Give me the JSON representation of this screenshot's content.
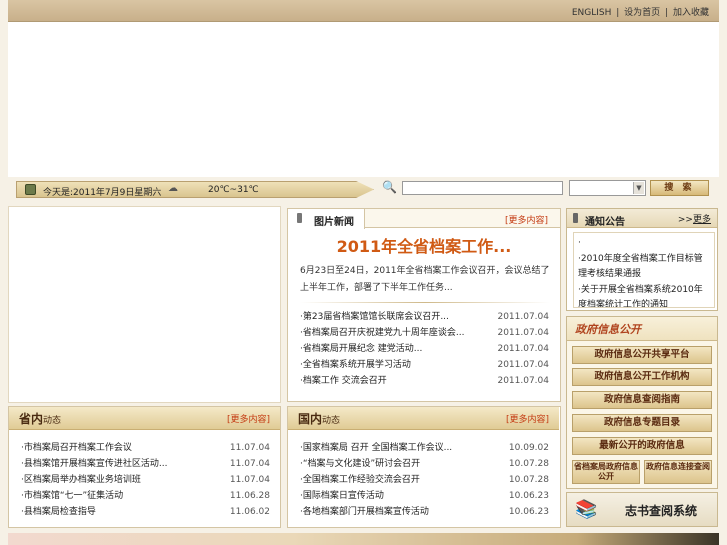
{
  "top_links": {
    "english": "ENGLISH",
    "sep": "|",
    "link2": "设为首页",
    "link3": "加入收藏"
  },
  "status": {
    "date": "今天是:2011年7月9日星期六",
    "temp": "20℃~31℃"
  },
  "search": {
    "button": "搜 索",
    "placeholder": ""
  },
  "news": {
    "tab": "图片新闻",
    "more": "[更多内容]",
    "headline": "2011年全省档案工作...",
    "summary": "6月23日至24日，2011年全省档案工作会议召开，会议总结了上半年工作，部署了下半年工作任务...",
    "items": [
      {
        "title": "·第23届省档案馆馆长联席会议召开...",
        "date": "2011.07.04"
      },
      {
        "title": "·省档案局召开庆祝建党九十周年座谈会...",
        "date": "2011.07.04"
      },
      {
        "title": "·省档案局开展纪念 建党活动...",
        "date": "2011.07.04"
      },
      {
        "title": "·全省档案系统开展学习活动",
        "date": "2011.07.04"
      },
      {
        "title": "·档案工作 交流会召开",
        "date": "2011.07.04"
      }
    ]
  },
  "provincial": {
    "title": "省内",
    "title_small": "动态",
    "more": "[更多内容]",
    "items": [
      {
        "title": "·市档案局召开档案工作会议",
        "date": "11.07.04"
      },
      {
        "title": "·县档案馆开展档案宣传进社区活动...",
        "date": "11.07.04"
      },
      {
        "title": "·区档案局举办档案业务培训班",
        "date": "11.07.04"
      },
      {
        "title": "·市档案馆“七一”征集活动",
        "date": "11.06.28"
      },
      {
        "title": "·县档案局检查指导",
        "date": "11.06.02"
      }
    ]
  },
  "domestic": {
    "title": "国内",
    "title_small": "动态",
    "more": "[更多内容]",
    "items": [
      {
        "title": "·国家档案局 召开 全国档案工作会议...",
        "date": "10.09.02"
      },
      {
        "title": "·“档案与文化建设”研讨会召开",
        "date": "10.07.28"
      },
      {
        "title": "·全国档案工作经验交流会召开",
        "date": "10.07.28"
      },
      {
        "title": "·国际档案日宣传活动",
        "date": "10.06.23"
      },
      {
        "title": "·各地档案部门开展档案宣传活动",
        "date": "10.06.23"
      }
    ]
  },
  "notice": {
    "title": "通知公告",
    "more_prefix": ">>",
    "more": "更多",
    "lines": [
      "·",
      "·2010年度全省档案工作目标管理考核结果通报",
      "·关于开展全省档案系统2010年度档案统计工作的通知"
    ]
  },
  "gov": {
    "title": "政府信息公开",
    "buttons": [
      "政府信息公开共享平台",
      "政府信息公开工作机构",
      "政府信息查阅指南",
      "政府信息专题目录",
      "最新公开的政府信息"
    ],
    "half_left": "省档案局政府信息公开",
    "half_right": "政府信息连接查阅"
  },
  "zhishu": {
    "label": "志书查阅系统"
  }
}
